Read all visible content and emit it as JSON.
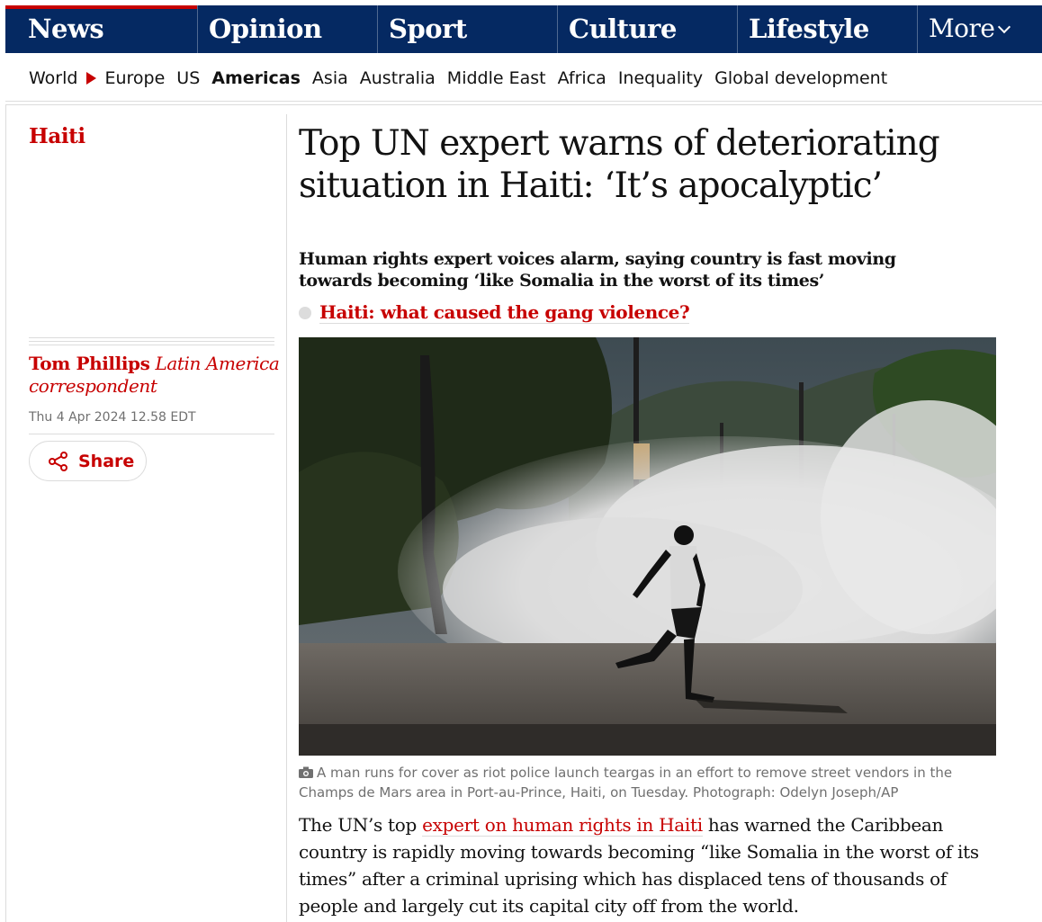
{
  "nav": {
    "pillars": [
      {
        "label": "News"
      },
      {
        "label": "Opinion"
      },
      {
        "label": "Sport"
      },
      {
        "label": "Culture"
      },
      {
        "label": "Lifestyle"
      }
    ],
    "more_label": "More"
  },
  "subnav": {
    "items": [
      "World",
      "Europe",
      "US",
      "Americas",
      "Asia",
      "Australia",
      "Middle East",
      "Africa",
      "Inequality",
      "Global development"
    ],
    "current": "Americas"
  },
  "article": {
    "section": "Haiti",
    "headline": "Top UN expert warns of deteriorating situation in Haiti: ‘It’s apocalyptic’",
    "standfirst": "Human rights expert voices alarm, saying country is fast moving towards becoming ‘like Somalia in the worst of its times’",
    "related_link": "Haiti: what caused the gang violence?",
    "author_name": "Tom Phillips",
    "author_role": "Latin America correspondent",
    "date": "Thu 4 Apr 2024 12.58 EDT",
    "share_label": "Share",
    "caption": "A man runs for cover as riot police launch teargas in an effort to remove street vendors in the Champs de Mars area in Port-au-Prince, Haiti, on Tuesday. Photograph: Odelyn Joseph/AP",
    "body_before": "The UN’s top ",
    "body_link": "expert on human rights in Haiti",
    "body_after": " has warned the Caribbean country is rapidly moving towards becoming “like Somalia in the worst of its times” after a criminal uprising which has displaced tens of thousands of people and largely cut its capital city off from the world."
  },
  "colors": {
    "brand_navy": "#052962",
    "news_red": "#c70000",
    "text": "#121212",
    "muted": "#707070",
    "rule": "#dcdcdc"
  },
  "icons": {
    "share": "share-icon",
    "camera": "camera-icon",
    "more_chevron": "chevron-down-icon"
  }
}
